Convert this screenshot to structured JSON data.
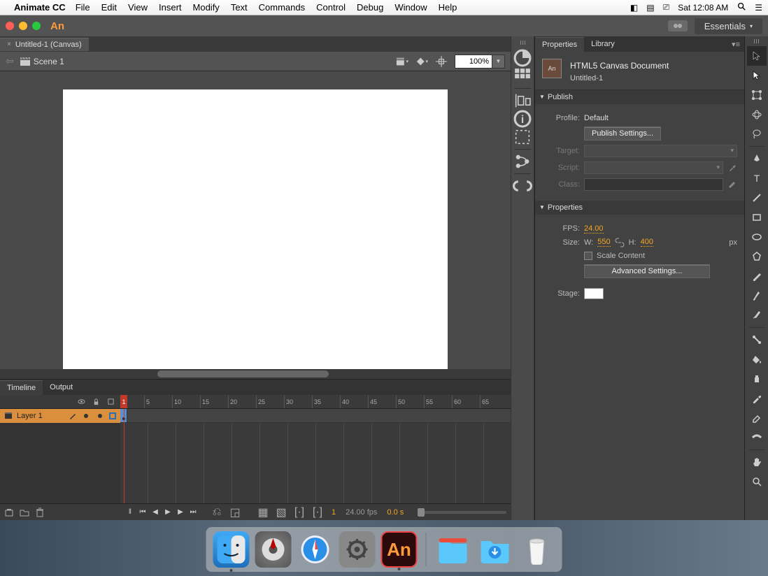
{
  "menubar": {
    "app": "Animate CC",
    "items": [
      "File",
      "Edit",
      "View",
      "Insert",
      "Modify",
      "Text",
      "Commands",
      "Control",
      "Debug",
      "Window",
      "Help"
    ],
    "clock": "Sat 12:08 AM"
  },
  "titlebar": {
    "logo": "An",
    "workspace": "Essentials"
  },
  "document": {
    "tab": "Untitled-1 (Canvas)",
    "scene": "Scene 1",
    "zoom": "100%"
  },
  "timeline": {
    "tabs": [
      "Timeline",
      "Output"
    ],
    "layer": "Layer 1",
    "ticks": [
      1,
      5,
      10,
      15,
      20,
      25,
      30,
      35,
      40,
      45,
      50,
      55,
      60,
      65
    ],
    "current_frame": "1",
    "fps_label": "24.00 fps",
    "time_label": "0.0 s"
  },
  "properties": {
    "tabs": [
      "Properties",
      "Library"
    ],
    "doc_type": "HTML5 Canvas Document",
    "doc_name": "Untitled-1",
    "publish": {
      "section": "Publish",
      "profile_label": "Profile:",
      "profile_value": "Default",
      "settings_btn": "Publish Settings...",
      "target_label": "Target:",
      "script_label": "Script:",
      "class_label": "Class:"
    },
    "props": {
      "section": "Properties",
      "fps_label": "FPS:",
      "fps_value": "24.00",
      "size_label": "Size:",
      "w_label": "W:",
      "w_value": "550",
      "h_label": "H:",
      "h_value": "400",
      "px_label": "px",
      "scale_label": "Scale Content",
      "advanced_btn": "Advanced Settings...",
      "stage_label": "Stage:"
    }
  },
  "dock": {
    "items": [
      "finder",
      "launchpad",
      "safari",
      "settings",
      "animate",
      "documents",
      "downloads",
      "trash"
    ]
  }
}
